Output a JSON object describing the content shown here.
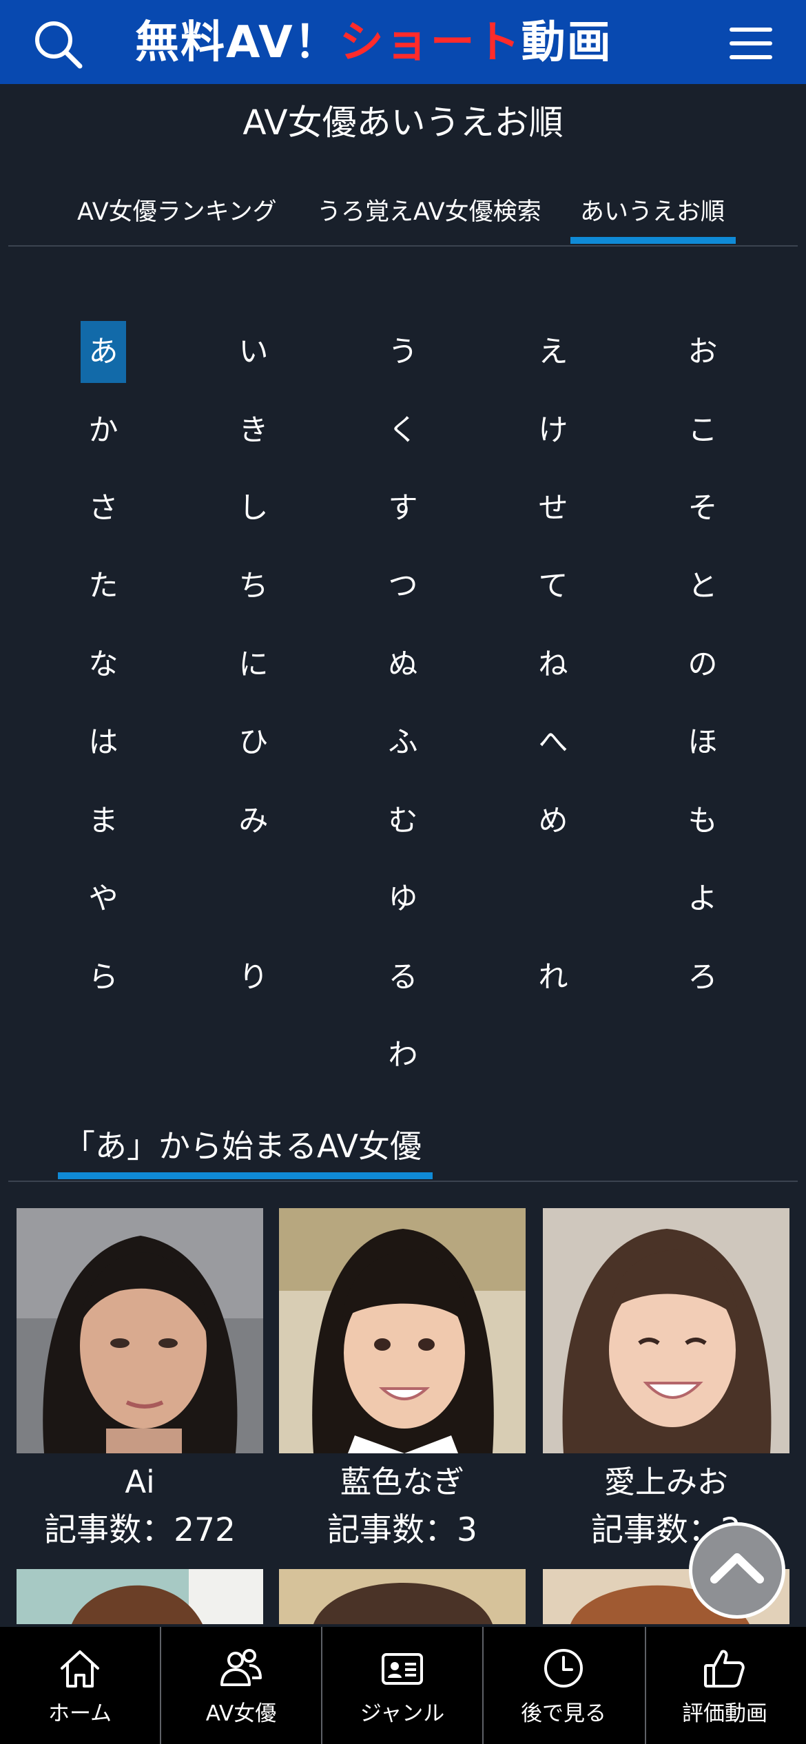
{
  "header": {
    "title_white_1": "無料AV！",
    "title_red": "ショート",
    "title_white_2": "動画",
    "brand_color": "#0849b0",
    "accent_red": "#ff2b2b",
    "search_icon": "search-icon",
    "menu_icon": "hamburger-menu-icon"
  },
  "page_title": "AV女優あいうえお順",
  "tabs": [
    {
      "label": "AV女優ランキング"
    },
    {
      "label": "うろ覚えAV女優検索"
    },
    {
      "label": "あいうえお順",
      "active": true
    }
  ],
  "kana": {
    "selected": "あ",
    "rows": [
      [
        "あ",
        "い",
        "う",
        "え",
        "お"
      ],
      [
        "か",
        "き",
        "く",
        "け",
        "こ"
      ],
      [
        "さ",
        "し",
        "す",
        "せ",
        "そ"
      ],
      [
        "た",
        "ち",
        "つ",
        "て",
        "と"
      ],
      [
        "な",
        "に",
        "ぬ",
        "ね",
        "の"
      ],
      [
        "は",
        "ひ",
        "ふ",
        "へ",
        "ほ"
      ],
      [
        "ま",
        "み",
        "む",
        "め",
        "も"
      ],
      [
        "や",
        "",
        "ゆ",
        "",
        "よ"
      ],
      [
        "ら",
        "り",
        "る",
        "れ",
        "ろ"
      ],
      [
        "",
        "",
        "わ",
        "",
        ""
      ]
    ]
  },
  "section": {
    "title": "「あ」から始まるAV女優"
  },
  "actresses": [
    {
      "name": "Ai",
      "count": "記事数：272"
    },
    {
      "name": "藍色なぎ",
      "count": "記事数：3"
    },
    {
      "name": "愛上みお",
      "count": "記事数：2"
    }
  ],
  "bottom_nav": [
    {
      "label": "ホーム",
      "icon": "home-icon"
    },
    {
      "label": "AV女優",
      "icon": "users-icon"
    },
    {
      "label": "ジャンル",
      "icon": "id-card-icon"
    },
    {
      "label": "後で見る",
      "icon": "clock-icon"
    },
    {
      "label": "評価動画",
      "icon": "thumbs-up-icon"
    }
  ],
  "colors": {
    "background": "#19202b",
    "accent_blue": "#0f8ad6",
    "selected_kana": "#126aa9"
  }
}
